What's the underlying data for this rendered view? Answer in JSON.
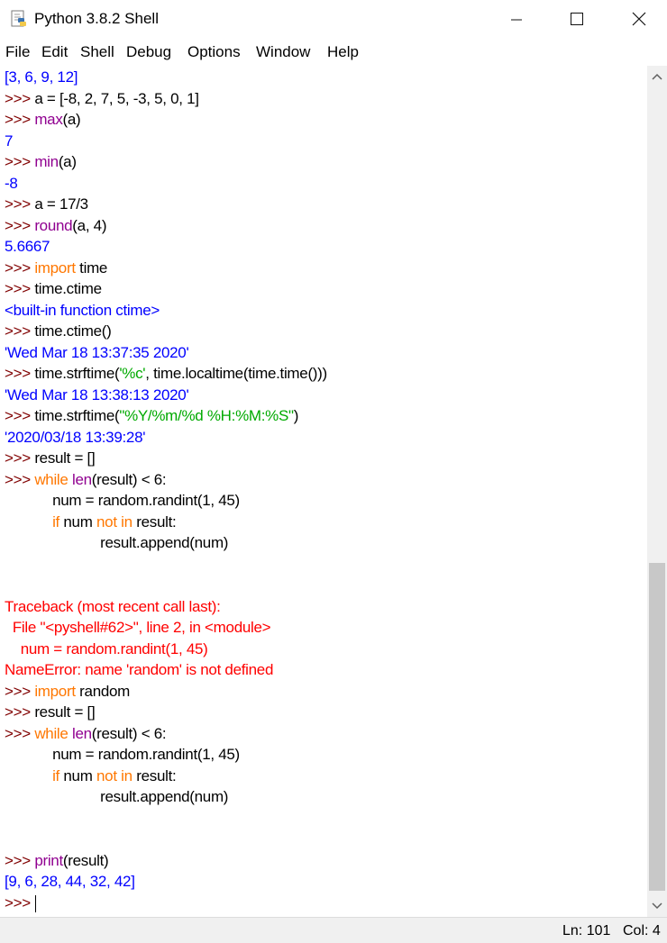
{
  "window": {
    "title": "Python 3.8.2 Shell",
    "minimize_glyph": "–",
    "maximize_glyph": "☐",
    "close_glyph": "✕"
  },
  "menu": [
    "File",
    "Edit",
    "Shell",
    "Debug",
    "Options",
    "Window",
    "Help"
  ],
  "colors": {
    "default": "#000000",
    "prompt": "#800000",
    "output": "#0000ff",
    "builtin": "#900090",
    "keyword": "#ff7700",
    "string": "#00aa00",
    "error": "#ff0000"
  },
  "lines": [
    [
      {
        "t": "[3, 6, 9, 12]",
        "c": "output"
      }
    ],
    [
      {
        "t": ">>> ",
        "c": "prompt"
      },
      {
        "t": "a = [-8, 2, 7, 5, -3, 5, 0, 1]",
        "c": "default"
      }
    ],
    [
      {
        "t": ">>> ",
        "c": "prompt"
      },
      {
        "t": "max",
        "c": "builtin"
      },
      {
        "t": "(a)",
        "c": "default"
      }
    ],
    [
      {
        "t": "7",
        "c": "output"
      }
    ],
    [
      {
        "t": ">>> ",
        "c": "prompt"
      },
      {
        "t": "min",
        "c": "builtin"
      },
      {
        "t": "(a)",
        "c": "default"
      }
    ],
    [
      {
        "t": "-8",
        "c": "output"
      }
    ],
    [
      {
        "t": ">>> ",
        "c": "prompt"
      },
      {
        "t": "a = 17/3",
        "c": "default"
      }
    ],
    [
      {
        "t": ">>> ",
        "c": "prompt"
      },
      {
        "t": "round",
        "c": "builtin"
      },
      {
        "t": "(a, 4)",
        "c": "default"
      }
    ],
    [
      {
        "t": "5.6667",
        "c": "output"
      }
    ],
    [
      {
        "t": ">>> ",
        "c": "prompt"
      },
      {
        "t": "import",
        "c": "keyword"
      },
      {
        "t": " time",
        "c": "default"
      }
    ],
    [
      {
        "t": ">>> ",
        "c": "prompt"
      },
      {
        "t": "time.ctime",
        "c": "default"
      }
    ],
    [
      {
        "t": "<built-in function ctime>",
        "c": "output"
      }
    ],
    [
      {
        "t": ">>> ",
        "c": "prompt"
      },
      {
        "t": "time.ctime()",
        "c": "default"
      }
    ],
    [
      {
        "t": "'Wed Mar 18 13:37:35 2020'",
        "c": "output"
      }
    ],
    [
      {
        "t": ">>> ",
        "c": "prompt"
      },
      {
        "t": "time.strftime(",
        "c": "default"
      },
      {
        "t": "'%c'",
        "c": "string"
      },
      {
        "t": ", time.localtime(time.time()))",
        "c": "default"
      }
    ],
    [
      {
        "t": "'Wed Mar 18 13:38:13 2020'",
        "c": "output"
      }
    ],
    [
      {
        "t": ">>> ",
        "c": "prompt"
      },
      {
        "t": "time.strftime(",
        "c": "default"
      },
      {
        "t": "\"%Y/%m/%d %H:%M:%S\"",
        "c": "string"
      },
      {
        "t": ")",
        "c": "default"
      }
    ],
    [
      {
        "t": "'2020/03/18 13:39:28'",
        "c": "output"
      }
    ],
    [
      {
        "t": ">>> ",
        "c": "prompt"
      },
      {
        "t": "result = []",
        "c": "default"
      }
    ],
    [
      {
        "t": ">>> ",
        "c": "prompt"
      },
      {
        "t": "while",
        "c": "keyword"
      },
      {
        "t": " ",
        "c": "default"
      },
      {
        "t": "len",
        "c": "builtin"
      },
      {
        "t": "(result) < 6:",
        "c": "default"
      }
    ],
    [
      {
        "t": "            num = random.randint(1, 45)",
        "c": "default"
      }
    ],
    [
      {
        "t": "            ",
        "c": "default"
      },
      {
        "t": "if",
        "c": "keyword"
      },
      {
        "t": " num ",
        "c": "default"
      },
      {
        "t": "not in",
        "c": "keyword"
      },
      {
        "t": " result:",
        "c": "default"
      }
    ],
    [
      {
        "t": "                        result.append(num)",
        "c": "default"
      }
    ],
    [],
    [],
    [
      {
        "t": "Traceback (most recent call last):",
        "c": "error"
      }
    ],
    [
      {
        "t": "  File \"<pyshell#62>\", line 2, in <module>",
        "c": "error"
      }
    ],
    [
      {
        "t": "    num = random.randint(1, 45)",
        "c": "error"
      }
    ],
    [
      {
        "t": "NameError: name 'random' is not defined",
        "c": "error"
      }
    ],
    [
      {
        "t": ">>> ",
        "c": "prompt"
      },
      {
        "t": "import",
        "c": "keyword"
      },
      {
        "t": " random",
        "c": "default"
      }
    ],
    [
      {
        "t": ">>> ",
        "c": "prompt"
      },
      {
        "t": "result = []",
        "c": "default"
      }
    ],
    [
      {
        "t": ">>> ",
        "c": "prompt"
      },
      {
        "t": "while",
        "c": "keyword"
      },
      {
        "t": " ",
        "c": "default"
      },
      {
        "t": "len",
        "c": "builtin"
      },
      {
        "t": "(result) < 6:",
        "c": "default"
      }
    ],
    [
      {
        "t": "            num = random.randint(1, 45)",
        "c": "default"
      }
    ],
    [
      {
        "t": "            ",
        "c": "default"
      },
      {
        "t": "if",
        "c": "keyword"
      },
      {
        "t": " num ",
        "c": "default"
      },
      {
        "t": "not in",
        "c": "keyword"
      },
      {
        "t": " result:",
        "c": "default"
      }
    ],
    [
      {
        "t": "                        result.append(num)",
        "c": "default"
      }
    ],
    [],
    [],
    [
      {
        "t": ">>> ",
        "c": "prompt"
      },
      {
        "t": "print",
        "c": "builtin"
      },
      {
        "t": "(result)",
        "c": "default"
      }
    ],
    [
      {
        "t": "[9, 6, 28, 44, 32, 42]",
        "c": "output"
      }
    ],
    [
      {
        "t": ">>> ",
        "c": "prompt"
      }
    ]
  ],
  "status": {
    "ln": "Ln: 101",
    "col": "Col: 4"
  }
}
